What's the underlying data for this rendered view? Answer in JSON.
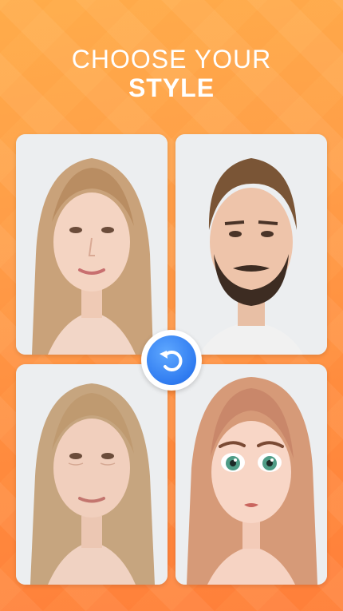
{
  "header": {
    "line1": "CHOOSE YOUR",
    "line2": "STYLE"
  },
  "cards": [
    {
      "name": "young-woman-photo"
    },
    {
      "name": "young-man-beard-photo"
    },
    {
      "name": "older-woman-photo"
    },
    {
      "name": "cartoon-girl-photo"
    }
  ],
  "swap_button": {
    "icon": "rotate-arrow-icon",
    "color": "#2f7bf0"
  },
  "colors": {
    "background": "#ff9d48",
    "accent": "#2f7bf0",
    "text": "#ffffff"
  }
}
